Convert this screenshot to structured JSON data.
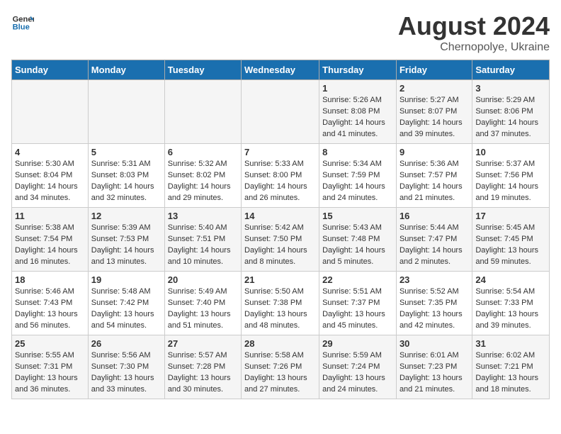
{
  "header": {
    "logo": {
      "general": "General",
      "blue": "Blue"
    },
    "title": "August 2024",
    "location": "Chernopolye, Ukraine"
  },
  "weekdays": [
    "Sunday",
    "Monday",
    "Tuesday",
    "Wednesday",
    "Thursday",
    "Friday",
    "Saturday"
  ],
  "weeks": [
    [
      {
        "day": "",
        "info": ""
      },
      {
        "day": "",
        "info": ""
      },
      {
        "day": "",
        "info": ""
      },
      {
        "day": "",
        "info": ""
      },
      {
        "day": "1",
        "info": "Sunrise: 5:26 AM\nSunset: 8:08 PM\nDaylight: 14 hours\nand 41 minutes."
      },
      {
        "day": "2",
        "info": "Sunrise: 5:27 AM\nSunset: 8:07 PM\nDaylight: 14 hours\nand 39 minutes."
      },
      {
        "day": "3",
        "info": "Sunrise: 5:29 AM\nSunset: 8:06 PM\nDaylight: 14 hours\nand 37 minutes."
      }
    ],
    [
      {
        "day": "4",
        "info": "Sunrise: 5:30 AM\nSunset: 8:04 PM\nDaylight: 14 hours\nand 34 minutes."
      },
      {
        "day": "5",
        "info": "Sunrise: 5:31 AM\nSunset: 8:03 PM\nDaylight: 14 hours\nand 32 minutes."
      },
      {
        "day": "6",
        "info": "Sunrise: 5:32 AM\nSunset: 8:02 PM\nDaylight: 14 hours\nand 29 minutes."
      },
      {
        "day": "7",
        "info": "Sunrise: 5:33 AM\nSunset: 8:00 PM\nDaylight: 14 hours\nand 26 minutes."
      },
      {
        "day": "8",
        "info": "Sunrise: 5:34 AM\nSunset: 7:59 PM\nDaylight: 14 hours\nand 24 minutes."
      },
      {
        "day": "9",
        "info": "Sunrise: 5:36 AM\nSunset: 7:57 PM\nDaylight: 14 hours\nand 21 minutes."
      },
      {
        "day": "10",
        "info": "Sunrise: 5:37 AM\nSunset: 7:56 PM\nDaylight: 14 hours\nand 19 minutes."
      }
    ],
    [
      {
        "day": "11",
        "info": "Sunrise: 5:38 AM\nSunset: 7:54 PM\nDaylight: 14 hours\nand 16 minutes."
      },
      {
        "day": "12",
        "info": "Sunrise: 5:39 AM\nSunset: 7:53 PM\nDaylight: 14 hours\nand 13 minutes."
      },
      {
        "day": "13",
        "info": "Sunrise: 5:40 AM\nSunset: 7:51 PM\nDaylight: 14 hours\nand 10 minutes."
      },
      {
        "day": "14",
        "info": "Sunrise: 5:42 AM\nSunset: 7:50 PM\nDaylight: 14 hours\nand 8 minutes."
      },
      {
        "day": "15",
        "info": "Sunrise: 5:43 AM\nSunset: 7:48 PM\nDaylight: 14 hours\nand 5 minutes."
      },
      {
        "day": "16",
        "info": "Sunrise: 5:44 AM\nSunset: 7:47 PM\nDaylight: 14 hours\nand 2 minutes."
      },
      {
        "day": "17",
        "info": "Sunrise: 5:45 AM\nSunset: 7:45 PM\nDaylight: 13 hours\nand 59 minutes."
      }
    ],
    [
      {
        "day": "18",
        "info": "Sunrise: 5:46 AM\nSunset: 7:43 PM\nDaylight: 13 hours\nand 56 minutes."
      },
      {
        "day": "19",
        "info": "Sunrise: 5:48 AM\nSunset: 7:42 PM\nDaylight: 13 hours\nand 54 minutes."
      },
      {
        "day": "20",
        "info": "Sunrise: 5:49 AM\nSunset: 7:40 PM\nDaylight: 13 hours\nand 51 minutes."
      },
      {
        "day": "21",
        "info": "Sunrise: 5:50 AM\nSunset: 7:38 PM\nDaylight: 13 hours\nand 48 minutes."
      },
      {
        "day": "22",
        "info": "Sunrise: 5:51 AM\nSunset: 7:37 PM\nDaylight: 13 hours\nand 45 minutes."
      },
      {
        "day": "23",
        "info": "Sunrise: 5:52 AM\nSunset: 7:35 PM\nDaylight: 13 hours\nand 42 minutes."
      },
      {
        "day": "24",
        "info": "Sunrise: 5:54 AM\nSunset: 7:33 PM\nDaylight: 13 hours\nand 39 minutes."
      }
    ],
    [
      {
        "day": "25",
        "info": "Sunrise: 5:55 AM\nSunset: 7:31 PM\nDaylight: 13 hours\nand 36 minutes."
      },
      {
        "day": "26",
        "info": "Sunrise: 5:56 AM\nSunset: 7:30 PM\nDaylight: 13 hours\nand 33 minutes."
      },
      {
        "day": "27",
        "info": "Sunrise: 5:57 AM\nSunset: 7:28 PM\nDaylight: 13 hours\nand 30 minutes."
      },
      {
        "day": "28",
        "info": "Sunrise: 5:58 AM\nSunset: 7:26 PM\nDaylight: 13 hours\nand 27 minutes."
      },
      {
        "day": "29",
        "info": "Sunrise: 5:59 AM\nSunset: 7:24 PM\nDaylight: 13 hours\nand 24 minutes."
      },
      {
        "day": "30",
        "info": "Sunrise: 6:01 AM\nSunset: 7:23 PM\nDaylight: 13 hours\nand 21 minutes."
      },
      {
        "day": "31",
        "info": "Sunrise: 6:02 AM\nSunset: 7:21 PM\nDaylight: 13 hours\nand 18 minutes."
      }
    ]
  ]
}
